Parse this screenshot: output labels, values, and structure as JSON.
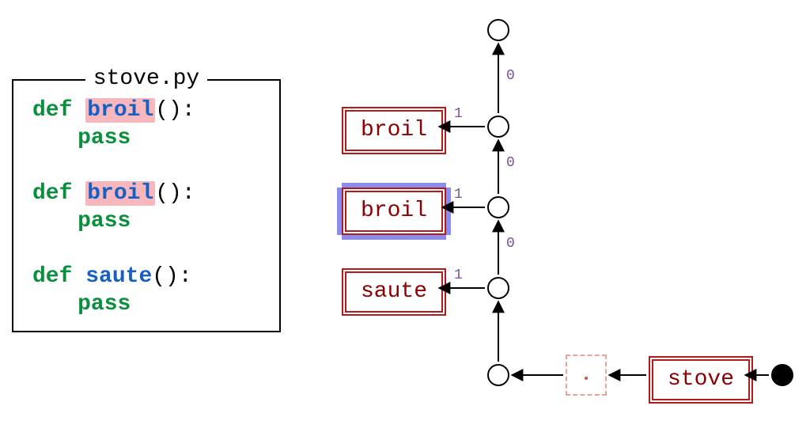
{
  "codebox": {
    "title": "stove.py",
    "lines": [
      {
        "kind": "def",
        "name": "broil",
        "highlight": true
      },
      {
        "kind": "pass"
      },
      {
        "kind": "blank"
      },
      {
        "kind": "def",
        "name": "broil",
        "highlight": true
      },
      {
        "kind": "pass"
      },
      {
        "kind": "blank"
      },
      {
        "kind": "def",
        "name": "saute",
        "highlight": false
      },
      {
        "kind": "pass"
      }
    ],
    "tokens": {
      "def": "def",
      "pass": "pass",
      "paren": "():"
    }
  },
  "diagram": {
    "funcs": [
      {
        "id": "broil-1",
        "label": "broil",
        "highlight": false
      },
      {
        "id": "broil-2",
        "label": "broil",
        "highlight": true
      },
      {
        "id": "saute",
        "label": "saute",
        "highlight": false
      }
    ],
    "module": {
      "label": "stove"
    },
    "edge_labels": {
      "zero": "0",
      "one": "1"
    }
  }
}
